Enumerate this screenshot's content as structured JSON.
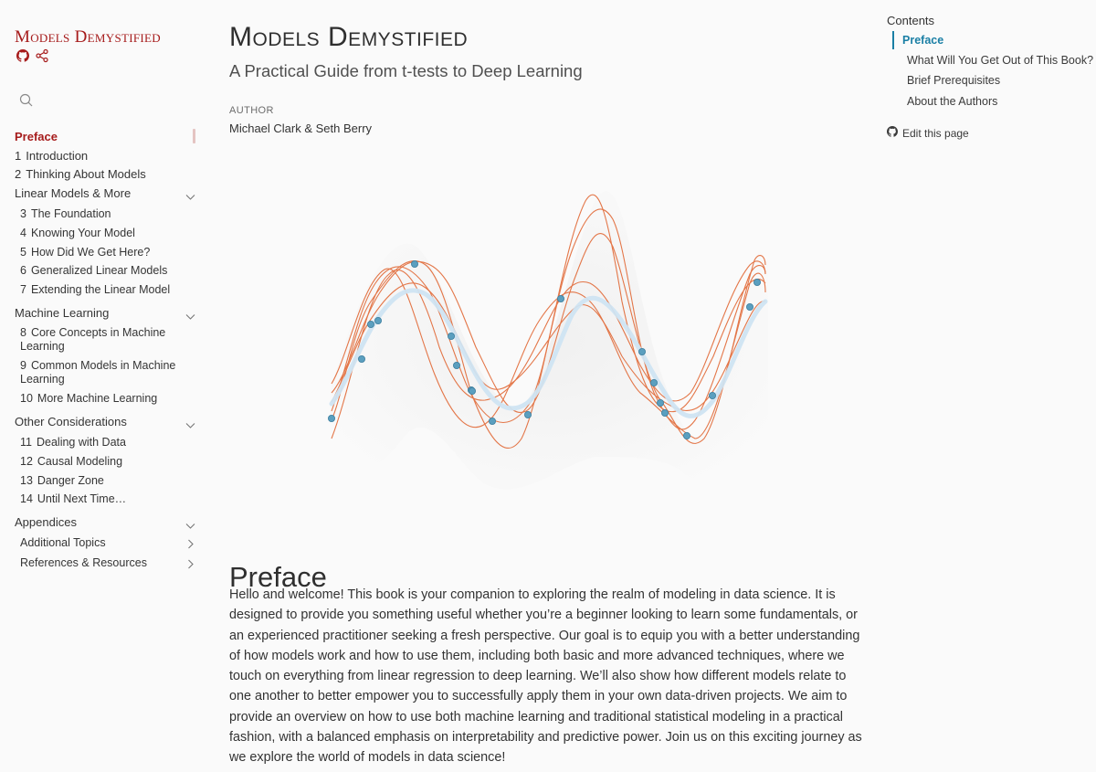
{
  "sidebar": {
    "brand": "Models Demystified",
    "items": [
      {
        "num": "",
        "label": "Preface",
        "active": true
      },
      {
        "num": "1",
        "label": "Introduction"
      },
      {
        "num": "2",
        "label": "Thinking About Models"
      }
    ],
    "sections": [
      {
        "label": "Linear Models & More",
        "items": [
          {
            "num": "3",
            "label": "The Foundation"
          },
          {
            "num": "4",
            "label": "Knowing Your Model"
          },
          {
            "num": "5",
            "label": "How Did We Get Here?"
          },
          {
            "num": "6",
            "label": "Generalized Linear Models"
          },
          {
            "num": "7",
            "label": "Extending the Linear Model"
          }
        ]
      },
      {
        "label": "Machine Learning",
        "items": [
          {
            "num": "8",
            "label": "Core Concepts in Machine",
            "label2": "Learning"
          },
          {
            "num": "9",
            "label": "Common Models in Machine",
            "label2": "Learning"
          },
          {
            "num": "10",
            "label": "More Machine Learning"
          }
        ]
      },
      {
        "label": "Other Considerations",
        "items": [
          {
            "num": "11",
            "label": "Dealing with Data"
          },
          {
            "num": "12",
            "label": "Causal Modeling"
          },
          {
            "num": "13",
            "label": "Danger Zone"
          },
          {
            "num": "14",
            "label": "Until Next Time…"
          }
        ]
      },
      {
        "label": "Appendices",
        "items": [
          {
            "num": "",
            "label": "Additional Topics"
          },
          {
            "num": "",
            "label": "References & Resources"
          }
        ]
      }
    ]
  },
  "main": {
    "title": "Models Demystified",
    "subtitle": "A Practical Guide from t-tests to Deep Learning",
    "author_label": "AUTHOR",
    "author": "Michael Clark & Seth Berry",
    "preface_heading": "Preface",
    "preface_text": "Hello and welcome! This book is your companion to exploring the realm of modeling in data science. It is designed to provide you something useful whether you’re a beginner looking to learn some fundamentals, or an experienced practitioner seeking a fresh perspective. Our goal is to equip you with a better understanding of how models work and how to use them, including both basic and more advanced techniques, where we touch on everything from linear regression to deep learning. We’ll also show how different models relate to one another to better empower you to successfully apply them in your own data-driven projects. We aim to provide an overview on how to use both machine learning and traditional statistical modeling in a practical fashion, with a balanced emphasis on interpretability and predictive power. Join us on this exciting journey as we explore the world of models in data science!"
  },
  "toc": {
    "title": "Contents",
    "items": [
      {
        "label": "Preface",
        "active": true
      },
      {
        "label": "What Will You Get Out of This Book?"
      },
      {
        "label": "Brief Prerequisites"
      },
      {
        "label": "About the Authors"
      }
    ],
    "edit_label": "Edit this page"
  },
  "colors": {
    "brand": "#a61b1b",
    "toc_accent": "#1a7fa5",
    "curve_orange": "#e0602a",
    "mean_curve": "#cfe4f2",
    "points": "#5b9fbf"
  },
  "icons": [
    "github-icon",
    "share-icon",
    "search-icon",
    "chevron-down-icon",
    "chevron-right-icon"
  ]
}
